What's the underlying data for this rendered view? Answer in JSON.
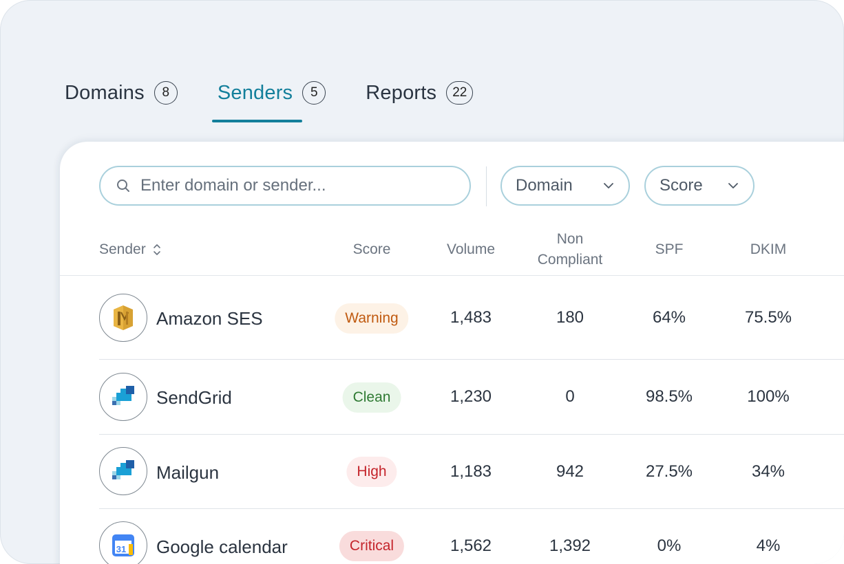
{
  "tabs": [
    {
      "label": "Domains",
      "count": "8",
      "active": false
    },
    {
      "label": "Senders",
      "count": "5",
      "active": true
    },
    {
      "label": "Reports",
      "count": "22",
      "active": false
    }
  ],
  "filters": {
    "search_placeholder": "Enter domain or sender...",
    "domain_label": "Domain",
    "score_label": "Score"
  },
  "table": {
    "columns": {
      "sender": "Sender",
      "score": "Score",
      "volume": "Volume",
      "non_compliant_line1": "Non",
      "non_compliant_line2": "Compliant",
      "spf": "SPF",
      "dkim": "DKIM"
    },
    "rows": [
      {
        "sender": "Amazon SES",
        "logo": "amazon-ses-icon",
        "score": "Warning",
        "score_color": "#c05a10",
        "score_bg": "#fdf2e6",
        "volume": "1,483",
        "non_compliant": "180",
        "spf": "64%",
        "dkim": "75.5%"
      },
      {
        "sender": "SendGrid",
        "logo": "sendgrid-icon",
        "score": "Clean",
        "score_color": "#2f7a33",
        "score_bg": "#eaf6ea",
        "volume": "1,230",
        "non_compliant": "0",
        "spf": "98.5%",
        "dkim": "100%"
      },
      {
        "sender": "Mailgun",
        "logo": "sendgrid-style-icon",
        "score": "High",
        "score_color": "#c4242b",
        "score_bg": "#fdecec",
        "volume": "1,183",
        "non_compliant": "942",
        "spf": "27.5%",
        "dkim": "34%"
      },
      {
        "sender": "Google calendar",
        "logo": "google-calendar-icon",
        "score": "Critical",
        "score_color": "#c4242b",
        "score_bg": "#f9dcdc",
        "volume": "1,562",
        "non_compliant": "1,392",
        "spf": "0%",
        "dkim": "4%"
      }
    ]
  },
  "colors": {
    "accent": "#137f9b",
    "input_border": "#a9d0dc",
    "background": "#eef2f7"
  }
}
